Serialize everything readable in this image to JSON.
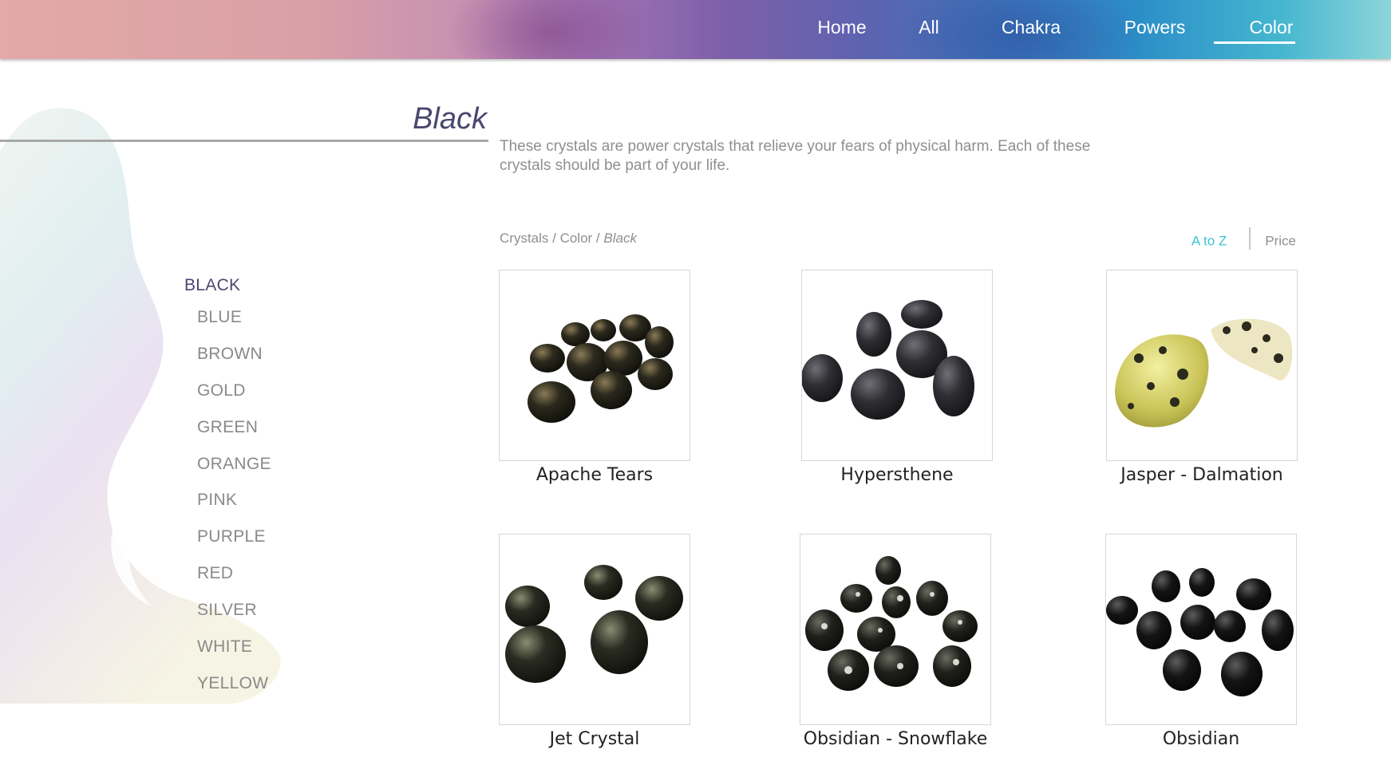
{
  "nav": {
    "items": [
      {
        "label": "Home"
      },
      {
        "label": "All"
      },
      {
        "label": "Chakra"
      },
      {
        "label": "Powers"
      },
      {
        "label": "Color"
      }
    ],
    "active": "Color"
  },
  "page": {
    "title": "Black",
    "description": "These crystals are power crystals that relieve your fears of physical harm. Each of these crystals should be part of your life."
  },
  "breadcrumb": {
    "crumbs": [
      "Crystals",
      "Color",
      "Black"
    ],
    "separator": " / "
  },
  "sort": {
    "a_to_z": "A to Z",
    "price": "Price",
    "active": "A to Z"
  },
  "sidebar": {
    "items": [
      {
        "label": "BLACK"
      },
      {
        "label": "BLUE"
      },
      {
        "label": "BROWN"
      },
      {
        "label": "GOLD"
      },
      {
        "label": "GREEN"
      },
      {
        "label": "ORANGE"
      },
      {
        "label": "PINK"
      },
      {
        "label": "PURPLE"
      },
      {
        "label": "RED"
      },
      {
        "label": "SILVER"
      },
      {
        "label": "WHITE"
      },
      {
        "label": "YELLOW"
      }
    ],
    "active": "BLACK"
  },
  "products": [
    {
      "name": "Apache Tears",
      "image": "apache-tears-stones"
    },
    {
      "name": "Hypersthene",
      "image": "hypersthene-stones"
    },
    {
      "name": "Jasper - Dalmation",
      "image": "dalmation-jasper-stones"
    },
    {
      "name": "Jet Crystal",
      "image": "jet-crystal-stones"
    },
    {
      "name": "Obsidian - Snowflake",
      "image": "snowflake-obsidian-stones"
    },
    {
      "name": "Obsidian",
      "image": "obsidian-stones"
    }
  ],
  "colors": {
    "accent": "#3ec3d5",
    "title": "#4a4770",
    "muted_text": "#8f8f8f"
  }
}
